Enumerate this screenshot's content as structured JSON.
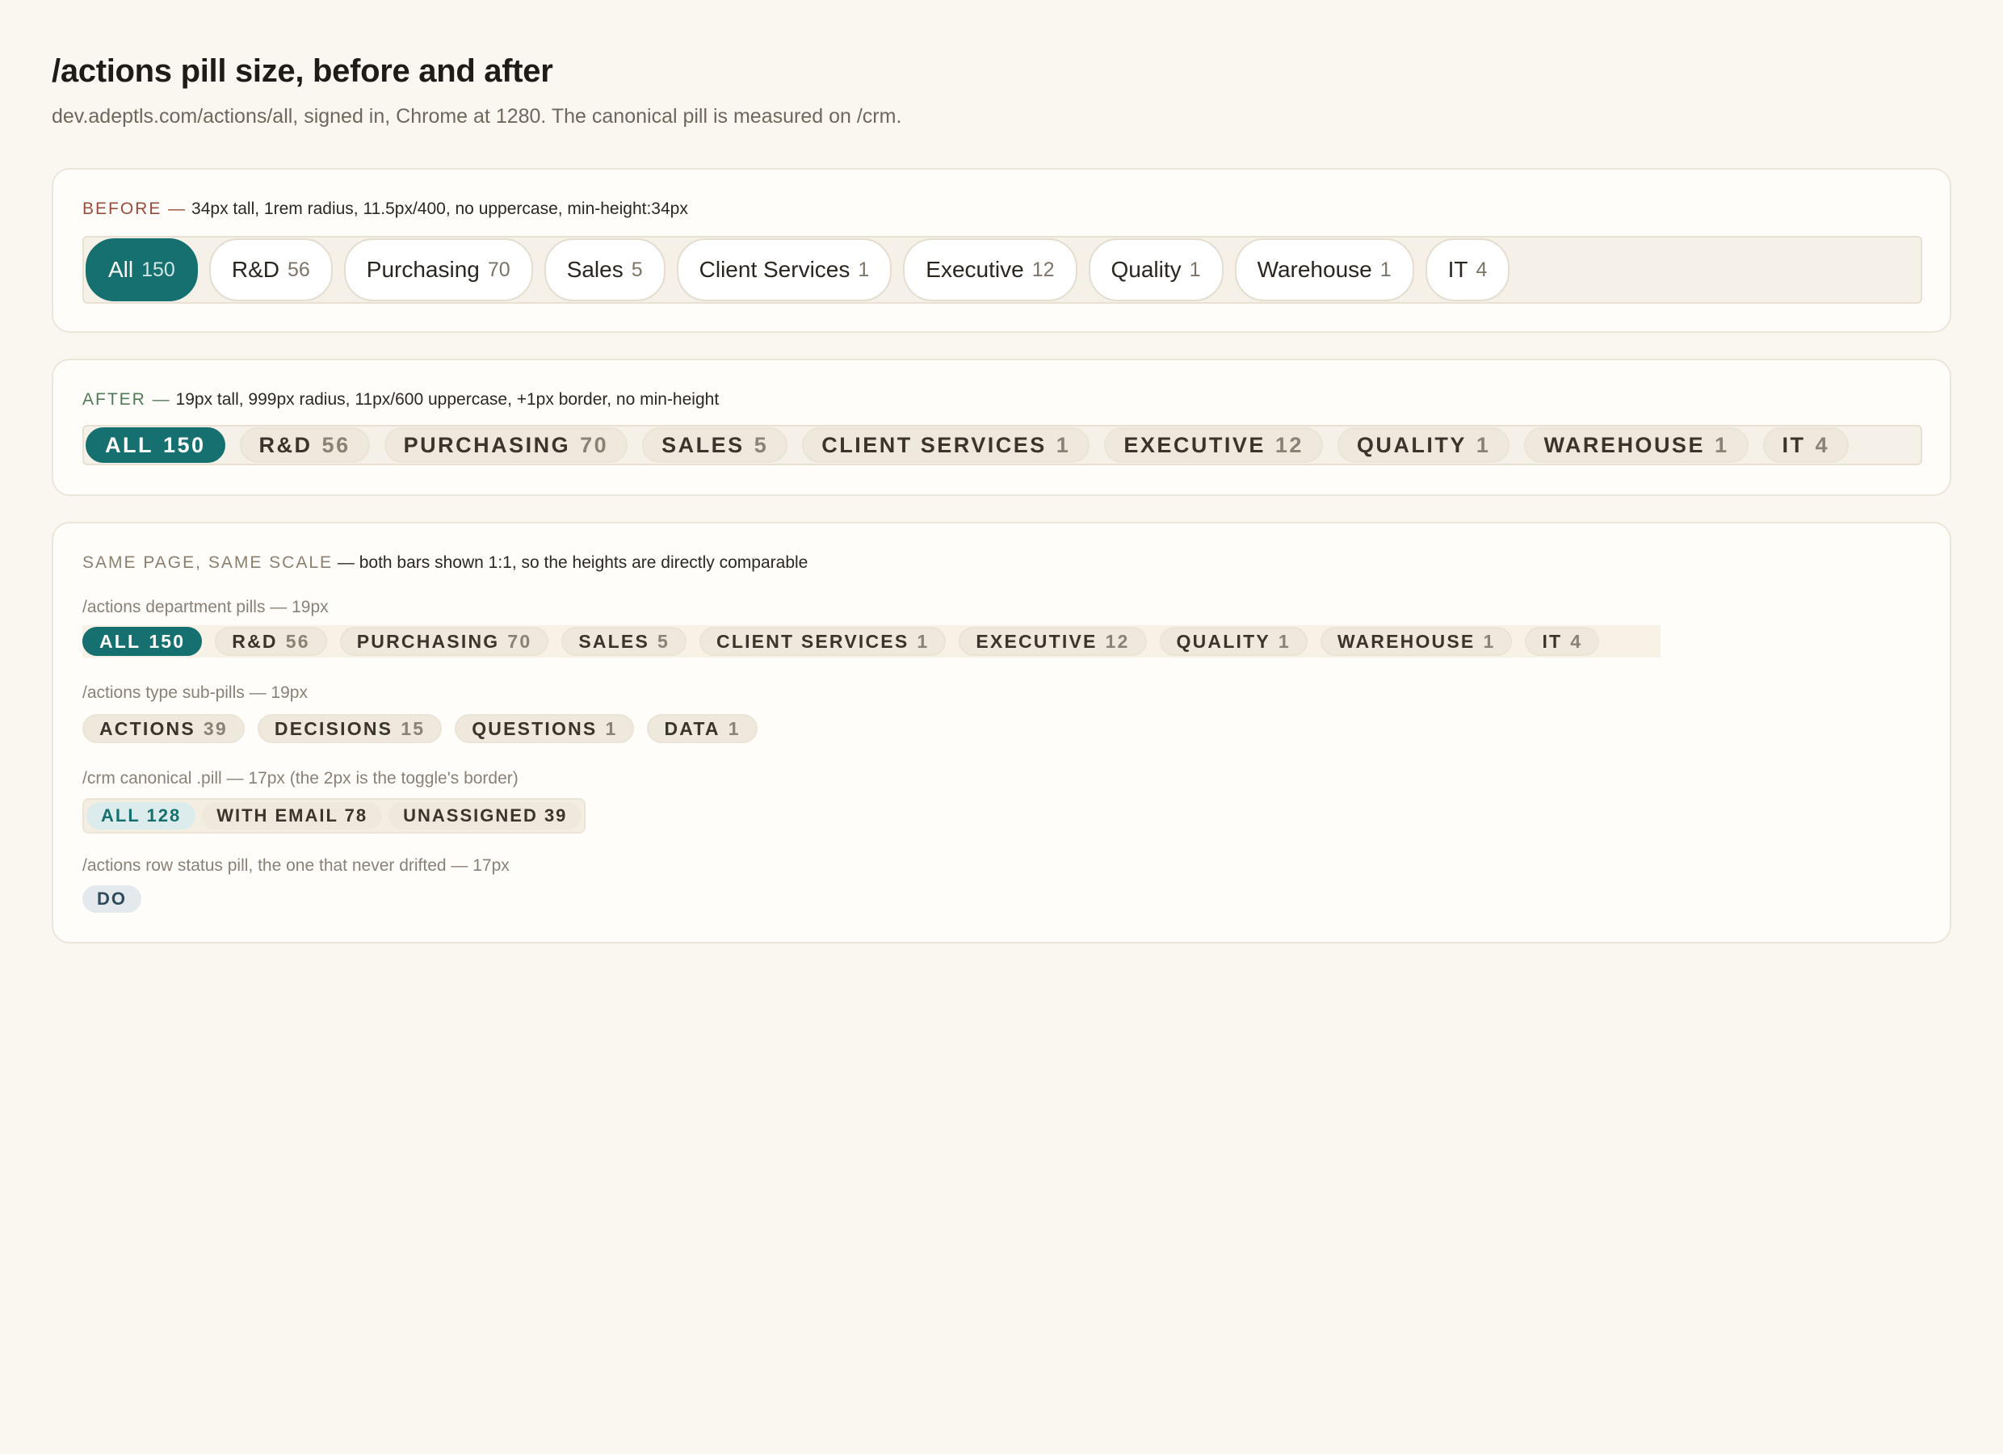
{
  "title": "/actions pill size, before and after",
  "subtitle": "dev.adeptls.com/actions/all, signed in, Chrome at 1280. The canonical pill is measured on /crm.",
  "before": {
    "tag": "BEFORE —",
    "desc": "34px tall, 1rem radius, 11.5px/400, no uppercase, min-height:34px",
    "pills": [
      {
        "label": "All",
        "count": "150"
      },
      {
        "label": "R&D",
        "count": "56"
      },
      {
        "label": "Purchasing",
        "count": "70"
      },
      {
        "label": "Sales",
        "count": "5"
      },
      {
        "label": "Client Services",
        "count": "1"
      },
      {
        "label": "Executive",
        "count": "12"
      },
      {
        "label": "Quality",
        "count": "1"
      },
      {
        "label": "Warehouse",
        "count": "1"
      },
      {
        "label": "IT",
        "count": "4"
      }
    ]
  },
  "after": {
    "tag": "AFTER —",
    "desc": "19px tall, 999px radius, 11px/600 uppercase, +1px border, no min-height",
    "pills": [
      {
        "label": "ALL",
        "count": "150"
      },
      {
        "label": "R&D",
        "count": "56"
      },
      {
        "label": "PURCHASING",
        "count": "70"
      },
      {
        "label": "SALES",
        "count": "5"
      },
      {
        "label": "CLIENT SERVICES",
        "count": "1"
      },
      {
        "label": "EXECUTIVE",
        "count": "12"
      },
      {
        "label": "QUALITY",
        "count": "1"
      },
      {
        "label": "WAREHOUSE",
        "count": "1"
      },
      {
        "label": "IT",
        "count": "4"
      }
    ]
  },
  "same": {
    "tag": "SAME PAGE, SAME SCALE",
    "desc": "— both bars shown 1:1, so the heights are directly comparable",
    "dept_label": "/actions department pills — 19px",
    "dept_pills": [
      {
        "label": "ALL",
        "count": "150"
      },
      {
        "label": "R&D",
        "count": "56"
      },
      {
        "label": "PURCHASING",
        "count": "70"
      },
      {
        "label": "SALES",
        "count": "5"
      },
      {
        "label": "CLIENT SERVICES",
        "count": "1"
      },
      {
        "label": "EXECUTIVE",
        "count": "12"
      },
      {
        "label": "QUALITY",
        "count": "1"
      },
      {
        "label": "WAREHOUSE",
        "count": "1"
      },
      {
        "label": "IT",
        "count": "4"
      }
    ],
    "type_label": "/actions type sub-pills — 19px",
    "type_pills": [
      {
        "label": "ACTIONS",
        "count": "39"
      },
      {
        "label": "DECISIONS",
        "count": "15"
      },
      {
        "label": "QUESTIONS",
        "count": "1"
      },
      {
        "label": "DATA",
        "count": "1"
      }
    ],
    "crm_label": "/crm canonical .pill — 17px (the 2px is the toggle's border)",
    "crm_pills": [
      "ALL 128",
      "WITH EMAIL 78",
      "UNASSIGNED 39"
    ],
    "status_label": "/actions row status pill, the one that never drifted — 17px",
    "status_pill": "DO"
  },
  "colors": {
    "accent": "#15706f",
    "background": "#faf7f1"
  }
}
